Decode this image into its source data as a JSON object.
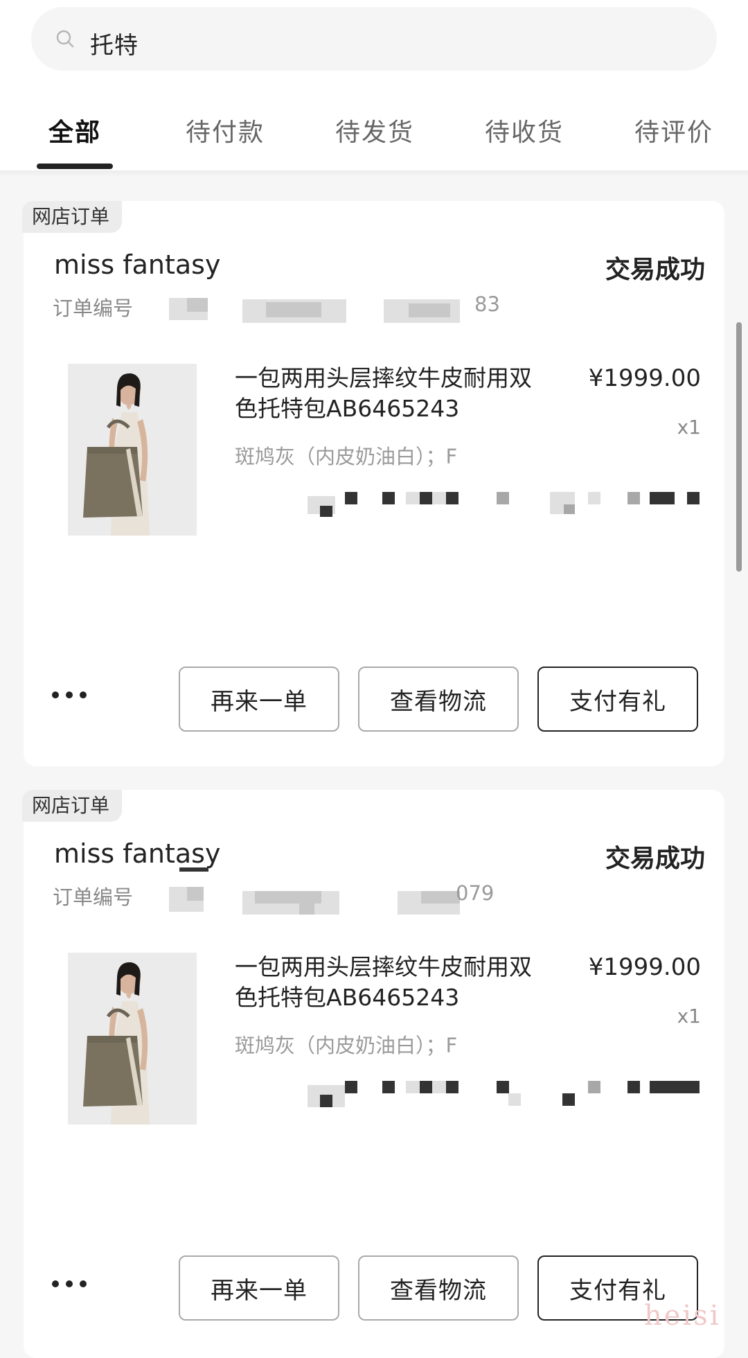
{
  "search": {
    "query": "托特"
  },
  "tabs": [
    {
      "label": "全部",
      "active": true
    },
    {
      "label": "待付款",
      "active": false
    },
    {
      "label": "待发货",
      "active": false
    },
    {
      "label": "待收货",
      "active": false
    },
    {
      "label": "待评价",
      "active": false
    }
  ],
  "orders": [
    {
      "badge": "网店订单",
      "shop_name": "miss fantasy",
      "status": "交易成功",
      "order_no_label": "订单编号",
      "order_no_visible_tail": "83",
      "product_title": "一包两用头层摔纹牛皮耐用双色托特包AB6465243",
      "price": "¥1999.00",
      "quantity": "x1",
      "spec": "斑鸠灰（内皮奶油白）；F",
      "actions": [
        "再来一单",
        "查看物流",
        "支付有礼"
      ]
    },
    {
      "badge": "网店订单",
      "shop_name": "miss fantasy",
      "status": "交易成功",
      "order_no_label": "订单编号",
      "order_no_visible_tail": "079",
      "product_title": "一包两用头层摔纹牛皮耐用双色托特包AB6465243",
      "price": "¥1999.00",
      "quantity": "x1",
      "spec": "斑鸠灰（内皮奶油白）；F",
      "actions": [
        "再来一单",
        "查看物流",
        "支付有礼"
      ]
    }
  ],
  "watermark": "heisi",
  "colors": {
    "page_bg": "#f6f6f6",
    "card_bg": "#ffffff",
    "active_tab": "#111111",
    "inactive_tab": "#666666",
    "muted_text": "#888888"
  },
  "icons": [
    "search-icon",
    "more-icon",
    "product-image-tote-bag"
  ]
}
